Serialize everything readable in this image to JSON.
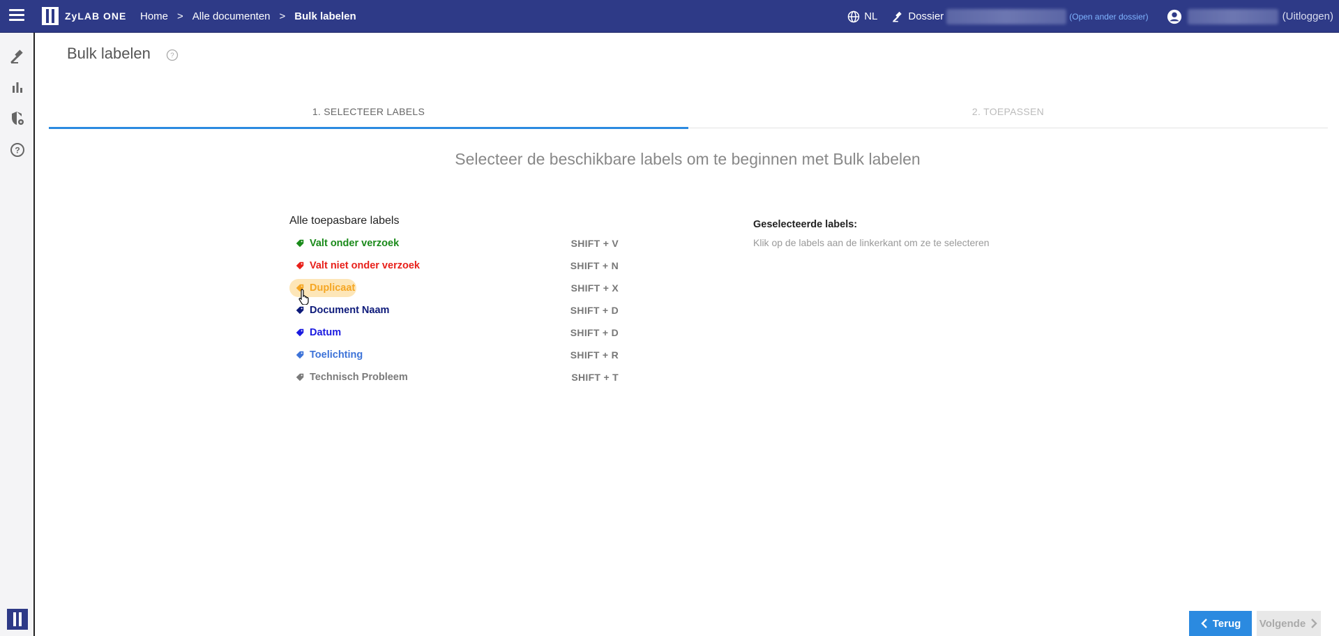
{
  "header": {
    "app_name": "ZyLAB ONE",
    "breadcrumbs": [
      "Home",
      "Alle documenten",
      "Bulk labelen"
    ],
    "language": "NL",
    "dossier_label": "Dossier",
    "open_other_dossier": "(Open ander dossier)",
    "logout": "(Uitloggen)"
  },
  "page": {
    "title": "Bulk labelen",
    "tabs": [
      {
        "label": "1. SELECTEER LABELS",
        "active": true
      },
      {
        "label": "2. TOEPASSEN",
        "active": false
      }
    ],
    "intro": "Selecteer de beschikbare labels om te beginnen met Bulk labelen"
  },
  "labels": {
    "section_title": "Alle toepasbare labels",
    "items": [
      {
        "name": "Valt onder verzoek",
        "shortcut": "SHIFT + V",
        "color": "#1a8a1a"
      },
      {
        "name": "Valt niet onder verzoek",
        "shortcut": "SHIFT + N",
        "color": "#e8201a"
      },
      {
        "name": "Duplicaat",
        "shortcut": "SHIFT + X",
        "color": "#f5a623"
      },
      {
        "name": "Document Naam",
        "shortcut": "SHIFT + D",
        "color": "#0d1a7a"
      },
      {
        "name": "Datum",
        "shortcut": "SHIFT + D",
        "color": "#1a1ae0"
      },
      {
        "name": "Toelichting",
        "shortcut": "SHIFT + R",
        "color": "#3d73d8"
      },
      {
        "name": "Technisch Probleem",
        "shortcut": "SHIFT + T",
        "color": "#7a7a7a"
      }
    ]
  },
  "selected": {
    "title": "Geselecteerde labels:",
    "hint": "Klik op de labels aan de linkerkant om ze te selecteren"
  },
  "buttons": {
    "back": "Terug",
    "next": "Volgende"
  },
  "colors": {
    "header_bg": "#2e3a87",
    "accent": "#2b8ae0"
  }
}
